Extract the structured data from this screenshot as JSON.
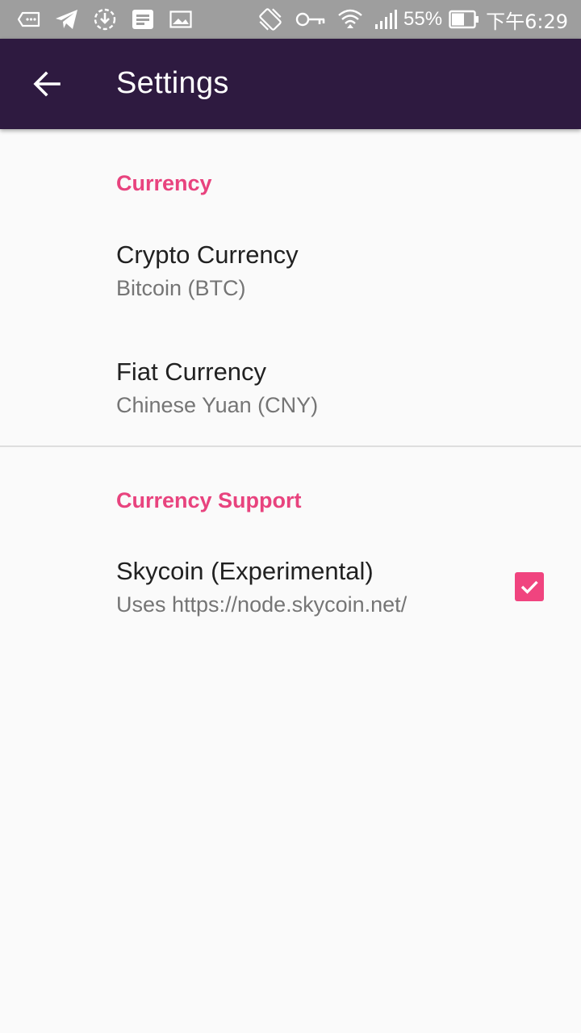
{
  "status_bar": {
    "icons_left": [
      "voicemail-icon",
      "telegram-icon",
      "download-icon",
      "news-icon",
      "image-icon"
    ],
    "icons_right": [
      "vibrate-icon",
      "vpn-key-icon",
      "wifi-icon",
      "signal-icon",
      "battery-icon"
    ],
    "battery": "55%",
    "time": "下午6:29"
  },
  "app_bar": {
    "title": "Settings",
    "background": "#2e1a40"
  },
  "sections": {
    "currency": {
      "header": "Currency",
      "crypto": {
        "title": "Crypto Currency",
        "summary": "Bitcoin (BTC)"
      },
      "fiat": {
        "title": "Fiat Currency",
        "summary": "Chinese Yuan (CNY)"
      }
    },
    "support": {
      "header": "Currency Support",
      "skycoin": {
        "title": "Skycoin (Experimental)",
        "summary": "Uses https://node.skycoin.net/",
        "checked": true
      }
    }
  },
  "colors": {
    "accent": "#e8437e",
    "checkbox": "#f0447f"
  }
}
